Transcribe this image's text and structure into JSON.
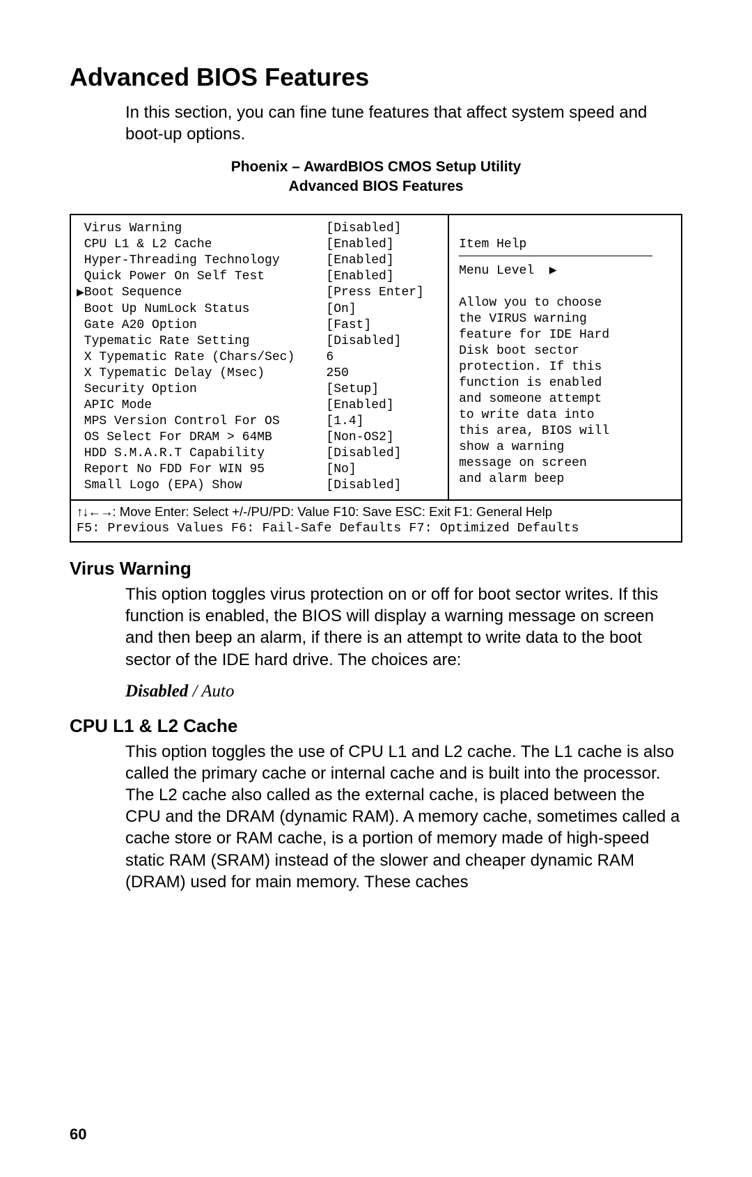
{
  "page_number": "60",
  "title": "Advanced BIOS Features",
  "intro": "In this section, you can fine tune features that affect system speed and boot-up options.",
  "bios_header_line1": "Phoenix – AwardBIOS CMOS Setup Utility",
  "bios_header_line2": "Advanced BIOS Features",
  "settings": [
    {
      "label": "Virus Warning",
      "value": "[Disabled]",
      "submenu": false
    },
    {
      "label": "CPU L1 & L2 Cache",
      "value": "[Enabled]",
      "submenu": false
    },
    {
      "label": "Hyper-Threading Technology",
      "value": "[Enabled]",
      "submenu": false
    },
    {
      "label": "Quick Power On Self Test",
      "value": "[Enabled]",
      "submenu": false
    },
    {
      "label": "Boot Sequence",
      "value": "[Press Enter]",
      "submenu": true
    },
    {
      "label": "Boot Up NumLock Status",
      "value": "[On]",
      "submenu": false
    },
    {
      "label": "Gate A20 Option",
      "value": "[Fast]",
      "submenu": false
    },
    {
      "label": "Typematic Rate Setting",
      "value": "[Disabled]",
      "submenu": false
    },
    {
      "label": "X Typematic Rate (Chars/Sec)",
      "value": "6",
      "submenu": false
    },
    {
      "label": "X Typematic Delay (Msec)",
      "value": "250",
      "submenu": false
    },
    {
      "label": "Security Option",
      "value": "[Setup]",
      "submenu": false
    },
    {
      "label": "APIC Mode",
      "value": "[Enabled]",
      "submenu": false
    },
    {
      "label": "MPS Version Control For OS",
      "value": "[1.4]",
      "submenu": false
    },
    {
      "label": "OS Select For DRAM > 64MB",
      "value": "[Non-OS2]",
      "submenu": false
    },
    {
      "label": "HDD S.M.A.R.T Capability",
      "value": "[Disabled]",
      "submenu": false
    },
    {
      "label": "Report No FDD For WIN 95",
      "value": "[No]",
      "submenu": false
    },
    {
      "label": "Small Logo (EPA) Show",
      "value": "[Disabled]",
      "submenu": false
    }
  ],
  "help": {
    "title": "Item Help",
    "menu_level": "Menu Level",
    "arrow": "▶",
    "lines": [
      "Allow you to choose",
      "the VIRUS warning",
      "feature for IDE Hard",
      "Disk boot sector",
      "protection. If this",
      "function is enabled",
      "and someone attempt",
      "to write data into",
      "this area, BIOS will",
      "show a warning",
      "message on screen",
      "and alarm beep"
    ]
  },
  "footer": {
    "arrows": "↑↓←→",
    "line1_rest": ": Move  Enter: Select  +/-/PU/PD: Value  F10: Save  ESC: Exit  F1: General Help",
    "line2": "F5: Previous Values   F6: Fail-Safe Defaults   F7: Optimized Defaults"
  },
  "sections": [
    {
      "heading": "Virus Warning",
      "body": "This option toggles virus protection on or off for boot sector writes. If this function is enabled, the BIOS will display a warning message on screen and then beep an alarm, if there is an attempt to write data to the boot sector of the IDE hard drive. The choices are:",
      "choice_bold": "Disabled",
      "choice_sep": " / ",
      "choice_rest": "Auto"
    },
    {
      "heading": "CPU L1 & L2 Cache",
      "body": "This option toggles the use of CPU L1 and L2 cache. The L1 cache is also called the primary cache or internal cache and is built into the processor. The L2 cache also called as the external cache, is placed between the CPU and the DRAM (dynamic RAM). A memory cache, sometimes called a cache store or RAM cache, is a portion of memory made of high-speed static RAM (SRAM) instead of the slower and cheaper dynamic RAM (DRAM) used for main memory. These caches"
    }
  ]
}
